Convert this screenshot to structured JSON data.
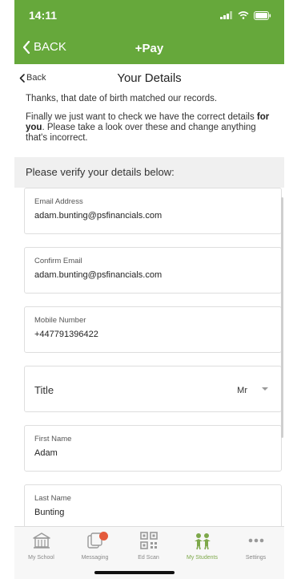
{
  "status_bar": {
    "time": "14:11"
  },
  "header": {
    "back_label": "BACK",
    "title": "+Pay"
  },
  "sub_header": {
    "back_label": "Back",
    "title": "Your Details"
  },
  "intro": {
    "line1": "Thanks, that date of birth matched our records.",
    "line2_prefix": "Finally we just want to check we have the correct details ",
    "line2_bold": "for you",
    "line2_suffix": ". Please take a look over these and change anything that's incorrect."
  },
  "verify_heading": "Please verify your details below:",
  "fields": [
    {
      "label": "Email Address",
      "value": "adam.bunting@psfinancials.com"
    },
    {
      "label": "Confirm Email",
      "value": "adam.bunting@psfinancials.com"
    },
    {
      "label": "Mobile Number",
      "value": "+447791396422"
    }
  ],
  "title_select": {
    "label": "Title",
    "value": "Mr"
  },
  "name_fields": [
    {
      "label": "First Name",
      "value": "Adam"
    },
    {
      "label": "Last Name",
      "value": "Bunting"
    }
  ],
  "tabs": [
    {
      "label": "My School",
      "icon": "school-icon"
    },
    {
      "label": "Messaging",
      "icon": "messaging-icon",
      "badge": ""
    },
    {
      "label": "Ed Scan",
      "icon": "qr-code-icon"
    },
    {
      "label": "My Students",
      "icon": "students-icon",
      "active": true
    },
    {
      "label": "Settings",
      "icon": "more-icon"
    }
  ],
  "colors": {
    "brand_green": "#66a83b",
    "badge_red": "#e45a3c"
  }
}
